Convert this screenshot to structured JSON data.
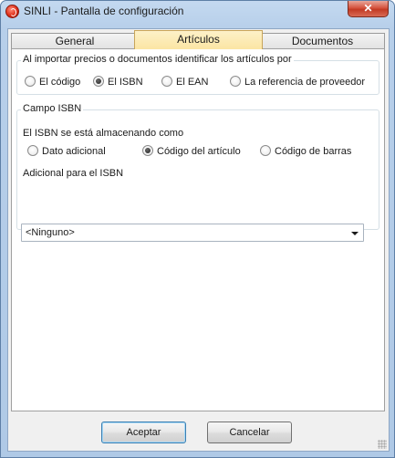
{
  "window": {
    "title": "SINLI - Pantalla de configuración",
    "close_label": "✕",
    "app_icon": "sinli-app-icon"
  },
  "tabs": [
    {
      "label": "General",
      "active": false
    },
    {
      "label": "Artículos",
      "active": true
    },
    {
      "label": "Documentos",
      "active": false
    }
  ],
  "import_group": {
    "label": "Al importar precios o documentos identificar los artículos por",
    "options": [
      {
        "label": "El código",
        "checked": false
      },
      {
        "label": "El ISBN",
        "checked": true
      },
      {
        "label": "El EAN",
        "checked": false
      },
      {
        "label": "La referencia de proveedor",
        "checked": false
      }
    ]
  },
  "isbn_group": {
    "label": "Campo ISBN",
    "stored_as_label": "El ISBN se está almacenando como",
    "options": [
      {
        "label": "Dato adicional",
        "checked": false
      },
      {
        "label": "Código del artículo",
        "checked": true
      },
      {
        "label": "Código de barras",
        "checked": false
      }
    ],
    "additional_label": "Adicional para el ISBN",
    "additional_value": "<Ninguno>"
  },
  "buttons": {
    "accept": "Aceptar",
    "cancel": "Cancelar"
  },
  "colors": {
    "active_tab": "#fbe5a3",
    "close_button": "#c23a24",
    "default_button_border": "#3c7fb1"
  }
}
